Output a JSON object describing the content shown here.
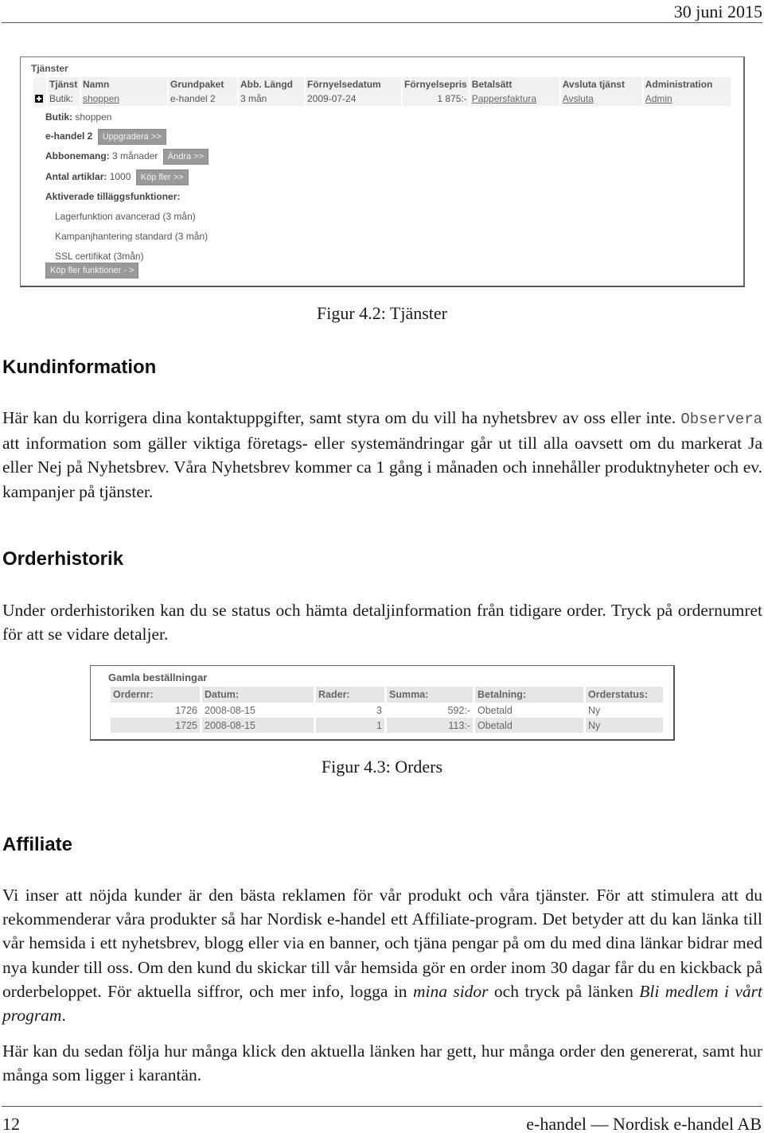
{
  "header": {
    "date": "30 juni 2015"
  },
  "figure_services": {
    "panel_title": "Tjänster",
    "columns": [
      "Tjänst",
      "Namn",
      "Grundpaket",
      "Abb. Längd",
      "Förnyelsedatum",
      "Förnyelsepris",
      "Betalsätt",
      "Avsluta tjänst",
      "Administration"
    ],
    "row": {
      "tjanst": "Butik:",
      "namn": "shoppen",
      "grundpaket": "e-handel 2",
      "abb_langd": "3 mån",
      "fornyelsedatum": "2009-07-24",
      "fornyelsepris": "1 875:-",
      "betalsatt": "Pappersfaktura",
      "avsluta": "Avsluta",
      "admin": "Admin"
    },
    "details": {
      "butik_label": "Butik:",
      "butik_value": "shoppen",
      "package_label": "e-handel 2",
      "upgrade_button": "Uppgradera >>",
      "subscription_label": "Abbonemang:",
      "subscription_value": "3 månader",
      "change_button": "Ändra >>",
      "articles_label": "Antal artiklar:",
      "articles_value": "1000",
      "buy_more_button": "Köp fler >>",
      "addons_label": "Aktiverade tilläggsfunktioner:",
      "addons": [
        "Lagerfunktion avancerad (3 mån)",
        "Kampanjhantering standard (3 mån)",
        "SSL certifikat (3mån)"
      ],
      "buy_more_functions_button": "Köp fler funktioner - >"
    },
    "caption": "Figur 4.2: Tjänster"
  },
  "sections": {
    "kundinformation": {
      "heading": "Kundinformation",
      "text_before_mono": "Här kan du korrigera dina kontaktuppgifter, samt styra om du vill ha nyhetsbrev av oss eller inte. ",
      "mono_word": "Observera",
      "text_after_mono": " att information som gäller viktiga företags- eller systemändringar går ut till alla oavsett om du markerat Ja eller Nej på Nyhetsbrev. Våra Nyhetsbrev kommer ca 1 gång i månaden och innehåller produktnyheter och ev. kampanjer på tjänster."
    },
    "orderhistorik": {
      "heading": "Orderhistorik",
      "text": "Under orderhistoriken kan du se status och hämta detaljinformation från tidigare order. Tryck på ordernumret för att se vidare detaljer."
    },
    "affiliate": {
      "heading": "Affiliate",
      "text_1": "Vi inser att nöjda kunder är den bästa reklamen för vår produkt och våra tjänster. För att stimulera att du rekommenderar våra produkter så har Nordisk e-handel ett Affiliate-program. Det betyder att du kan länka till vår hemsida i ett nyhetsbrev, blogg eller via en banner, och tjäna pengar på om du med dina länkar bidrar med nya kunder till oss. Om den kund du skickar till vår hemsida gör en order inom 30 dagar får du en kickback på orderbeloppet. För aktuella siffror, och mer info, logga in ",
      "italic_1": "mina sidor",
      "text_2": " och tryck på länken ",
      "italic_2": "Bli medlem i vårt program",
      "text_3": ".",
      "para_2": "Här kan du sedan följa hur många klick den aktuella länken har gett, hur många order den genererat, samt hur många som ligger i karantän."
    }
  },
  "figure_orders": {
    "panel_title": "Gamla beställningar",
    "columns": [
      "Ordernr:",
      "Datum:",
      "Rader:",
      "Summa:",
      "Betalning:",
      "Orderstatus:"
    ],
    "rows": [
      {
        "ordernr": "1726",
        "datum": "2008-08-15",
        "rader": "3",
        "summa": "592:-",
        "betalning": "Obetald",
        "status": "Ny"
      },
      {
        "ordernr": "1725",
        "datum": "2008-08-15",
        "rader": "1",
        "summa": "113:-",
        "betalning": "Obetald",
        "status": "Ny"
      }
    ],
    "caption": "Figur 4.3: Orders"
  },
  "footer": {
    "page_number": "12",
    "doc_title": "e-handel — Nordisk e-handel AB"
  }
}
